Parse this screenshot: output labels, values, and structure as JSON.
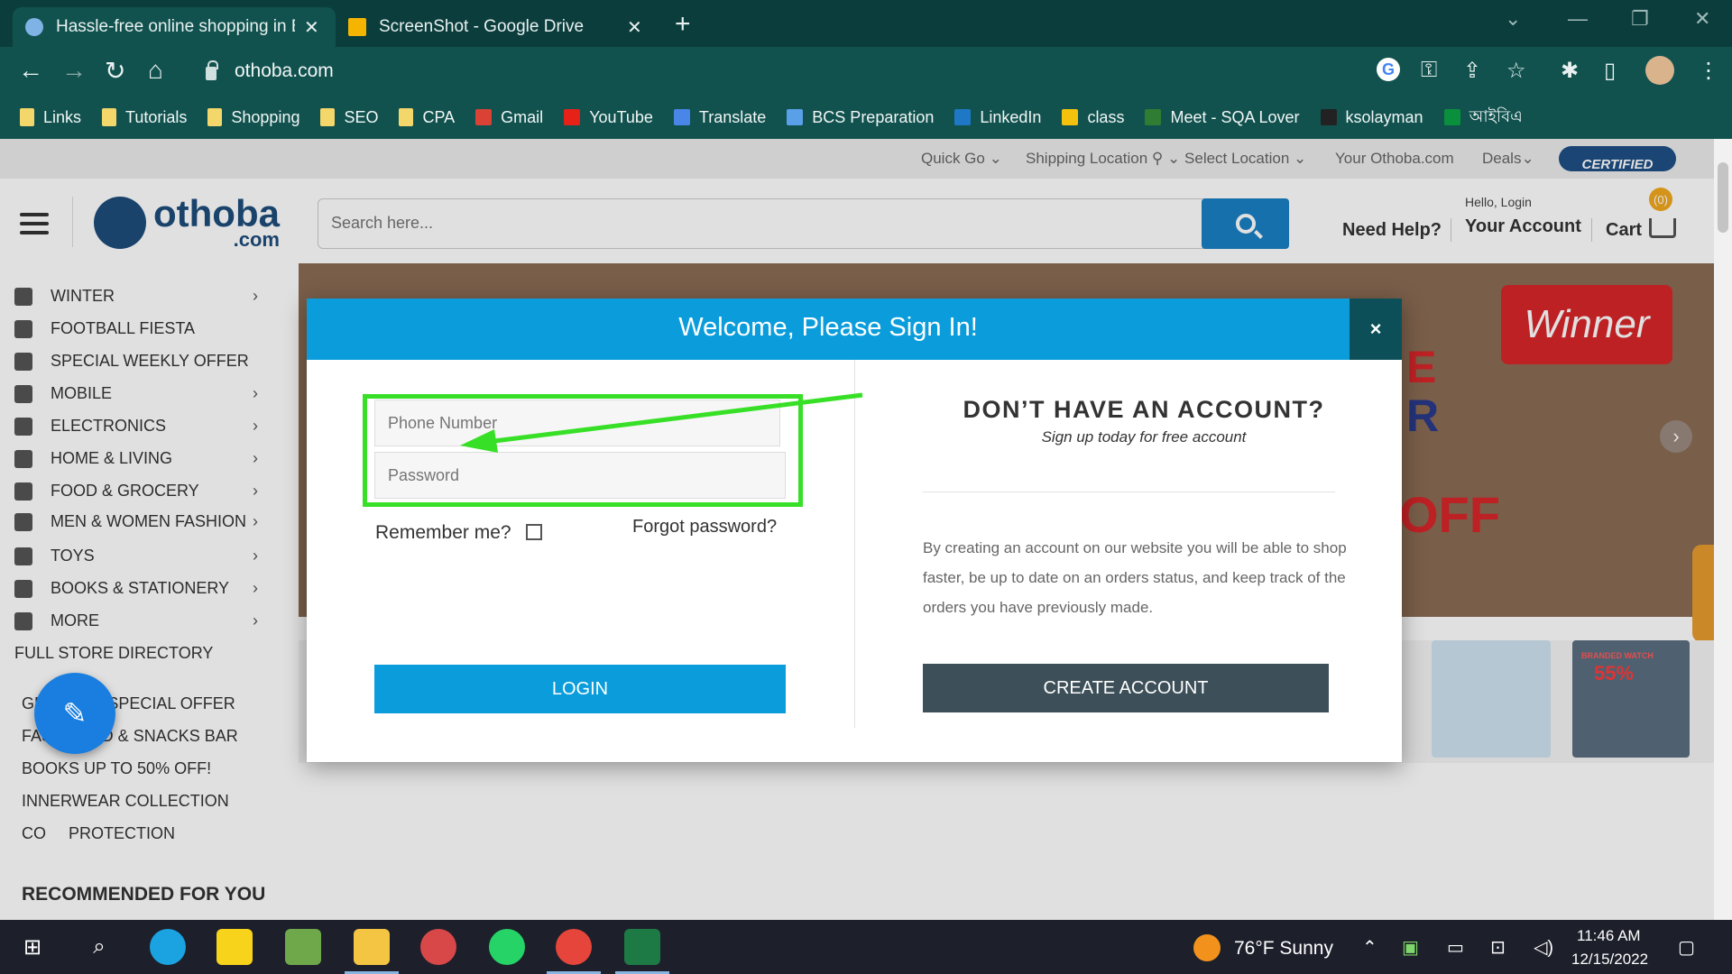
{
  "browser": {
    "tabs": [
      {
        "title": "Hassle-free online shopping in Ba",
        "favicon_color": "#7fb3e5"
      },
      {
        "title": "ScreenShot - Google Drive",
        "favicon_color": "#f4b400"
      }
    ],
    "new_tab": "+",
    "url": "othoba.com",
    "bookmarks": [
      {
        "label": "Links",
        "icon": "folder-icon"
      },
      {
        "label": "Tutorials",
        "icon": "folder-icon"
      },
      {
        "label": "Shopping",
        "icon": "folder-icon"
      },
      {
        "label": "SEO",
        "icon": "folder-icon"
      },
      {
        "label": "CPA",
        "icon": "folder-icon"
      },
      {
        "label": "Gmail",
        "icon": "gmail-icon",
        "color": "#d94235"
      },
      {
        "label": "YouTube",
        "icon": "youtube-icon",
        "color": "#e62117"
      },
      {
        "label": "Translate",
        "icon": "translate-icon",
        "color": "#4a86e8"
      },
      {
        "label": "BCS Preparation",
        "icon": "book-icon",
        "color": "#5aa0e8"
      },
      {
        "label": "LinkedIn",
        "icon": "linkedin-icon",
        "color": "#1f78c6"
      },
      {
        "label": "class",
        "icon": "classroom-icon",
        "color": "#f4c20d"
      },
      {
        "label": "Meet - SQA Lover",
        "icon": "meet-icon",
        "color": "#2e7d32"
      },
      {
        "label": "ksolayman",
        "icon": "github-icon",
        "color": "#222222"
      },
      {
        "label": "আইবিএ",
        "icon": "iba-icon",
        "color": "#0a8f3c"
      }
    ]
  },
  "site": {
    "topbar": {
      "quick_go": "Quick Go ⌄",
      "shipping": "Shipping Location ⚲ ⌄ Select Location ⌄",
      "your_othoba": "Your Othoba.com",
      "deals": "Deals⌄",
      "certified": "CERTIFIED"
    },
    "logo": {
      "name": "othoba",
      "suffix": ".com"
    },
    "search_placeholder": "Search here...",
    "need_help": "Need Help?",
    "hello": "Hello, Login",
    "your_account": "Your Account",
    "cart": "Cart",
    "cart_count": "(0)",
    "categories": [
      {
        "label": "WINTER",
        "icon": "snowflake-icon",
        "chevron": true
      },
      {
        "label": "FOOTBALL FIESTA",
        "icon": "football-icon",
        "chevron": false
      },
      {
        "label": "SPECIAL WEEKLY OFFER",
        "icon": "stopwatch-icon",
        "chevron": false
      },
      {
        "label": "MOBILE",
        "icon": "mobile-icon",
        "chevron": true
      },
      {
        "label": "ELECTRONICS",
        "icon": "electronics-icon",
        "chevron": true
      },
      {
        "label": "HOME & LIVING",
        "icon": "home-icon",
        "chevron": true
      },
      {
        "label": "FOOD & GROCERY",
        "icon": "basket-icon",
        "chevron": true
      },
      {
        "label": "MEN & WOMEN FASHION",
        "icon": "diamond-icon",
        "chevron": true
      },
      {
        "label": "TOYS",
        "icon": "toy-icon",
        "chevron": true
      },
      {
        "label": "BOOKS & STATIONERY",
        "icon": "book-icon",
        "chevron": true
      },
      {
        "label": "MORE",
        "icon": "more-icon",
        "chevron": true
      }
    ],
    "full_directory": "FULL STORE DIRECTORY",
    "promo_links": [
      "GROCERY SPECIAL OFFER",
      "FAST FOOD & SNACKS BAR",
      "BOOKS UP TO 50% OFF!",
      "INNERWEAR COLLECTION",
      "CO     PROTECTION"
    ],
    "recommended": "RECOMMENDED FOR YOU",
    "banner": {
      "brand": "Winner",
      "fragments": [
        "E",
        "R",
        "OFF"
      ]
    },
    "thumb_texts": [
      "BRANDED WATCH",
      "55%"
    ]
  },
  "modal": {
    "title": "Welcome, Please Sign In!",
    "close": "×",
    "phone_placeholder": "Phone Number",
    "password_placeholder": "Password",
    "remember": "Remember me?",
    "forgot": "Forgot password?",
    "login": "LOGIN",
    "no_account_title": "DON’T HAVE AN ACCOUNT?",
    "no_account_sub": "Sign up today for free account",
    "benefit": "By creating an account on our website you will be able to shop faster, be up to date on an orders status, and keep track of the orders you have previously made.",
    "create": "CREATE ACCOUNT"
  },
  "annotation": {
    "color": "#37e026"
  },
  "taskbar": {
    "weather": "76°F  Sunny",
    "time": "11:46 AM",
    "date": "12/15/2022"
  }
}
